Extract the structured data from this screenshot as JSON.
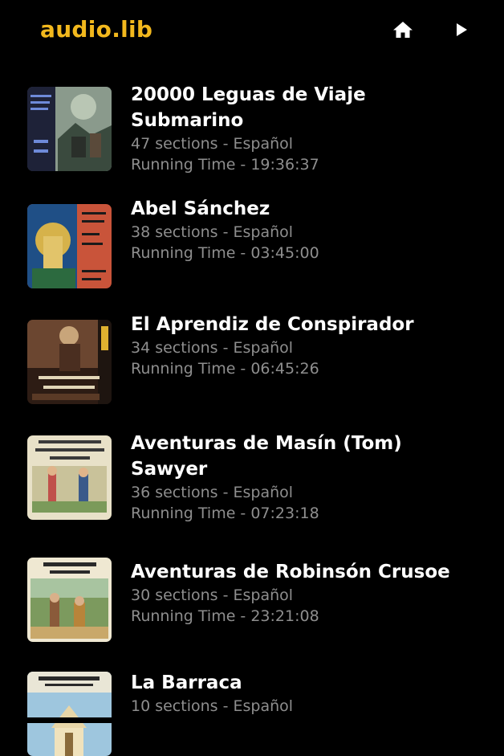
{
  "app": {
    "logo": "audio.lib",
    "accent_color": "#f2b81d",
    "icons": [
      "home-icon",
      "play-icon"
    ]
  },
  "books": [
    {
      "title": "20000 Leguas de Viaje Submarino",
      "sections": "47 sections - Español",
      "running_time": "Running Time - 19:36:37"
    },
    {
      "title": "Abel Sánchez",
      "sections": "38 sections - Español",
      "running_time": "Running Time - 03:45:00"
    },
    {
      "title": "El Aprendiz de Conspirador",
      "sections": "34 sections - Español",
      "running_time": "Running Time - 06:45:26"
    },
    {
      "title": "Aventuras de Masín (Tom) Sawyer",
      "sections": "36 sections - Español",
      "running_time": "Running Time - 07:23:18"
    },
    {
      "title": "Aventuras de Robinsón Crusoe",
      "sections": "30 sections - Español",
      "running_time": "Running Time - 23:21:08"
    },
    {
      "title": "La Barraca",
      "sections": "10 sections - Español",
      "running_time": ""
    }
  ]
}
